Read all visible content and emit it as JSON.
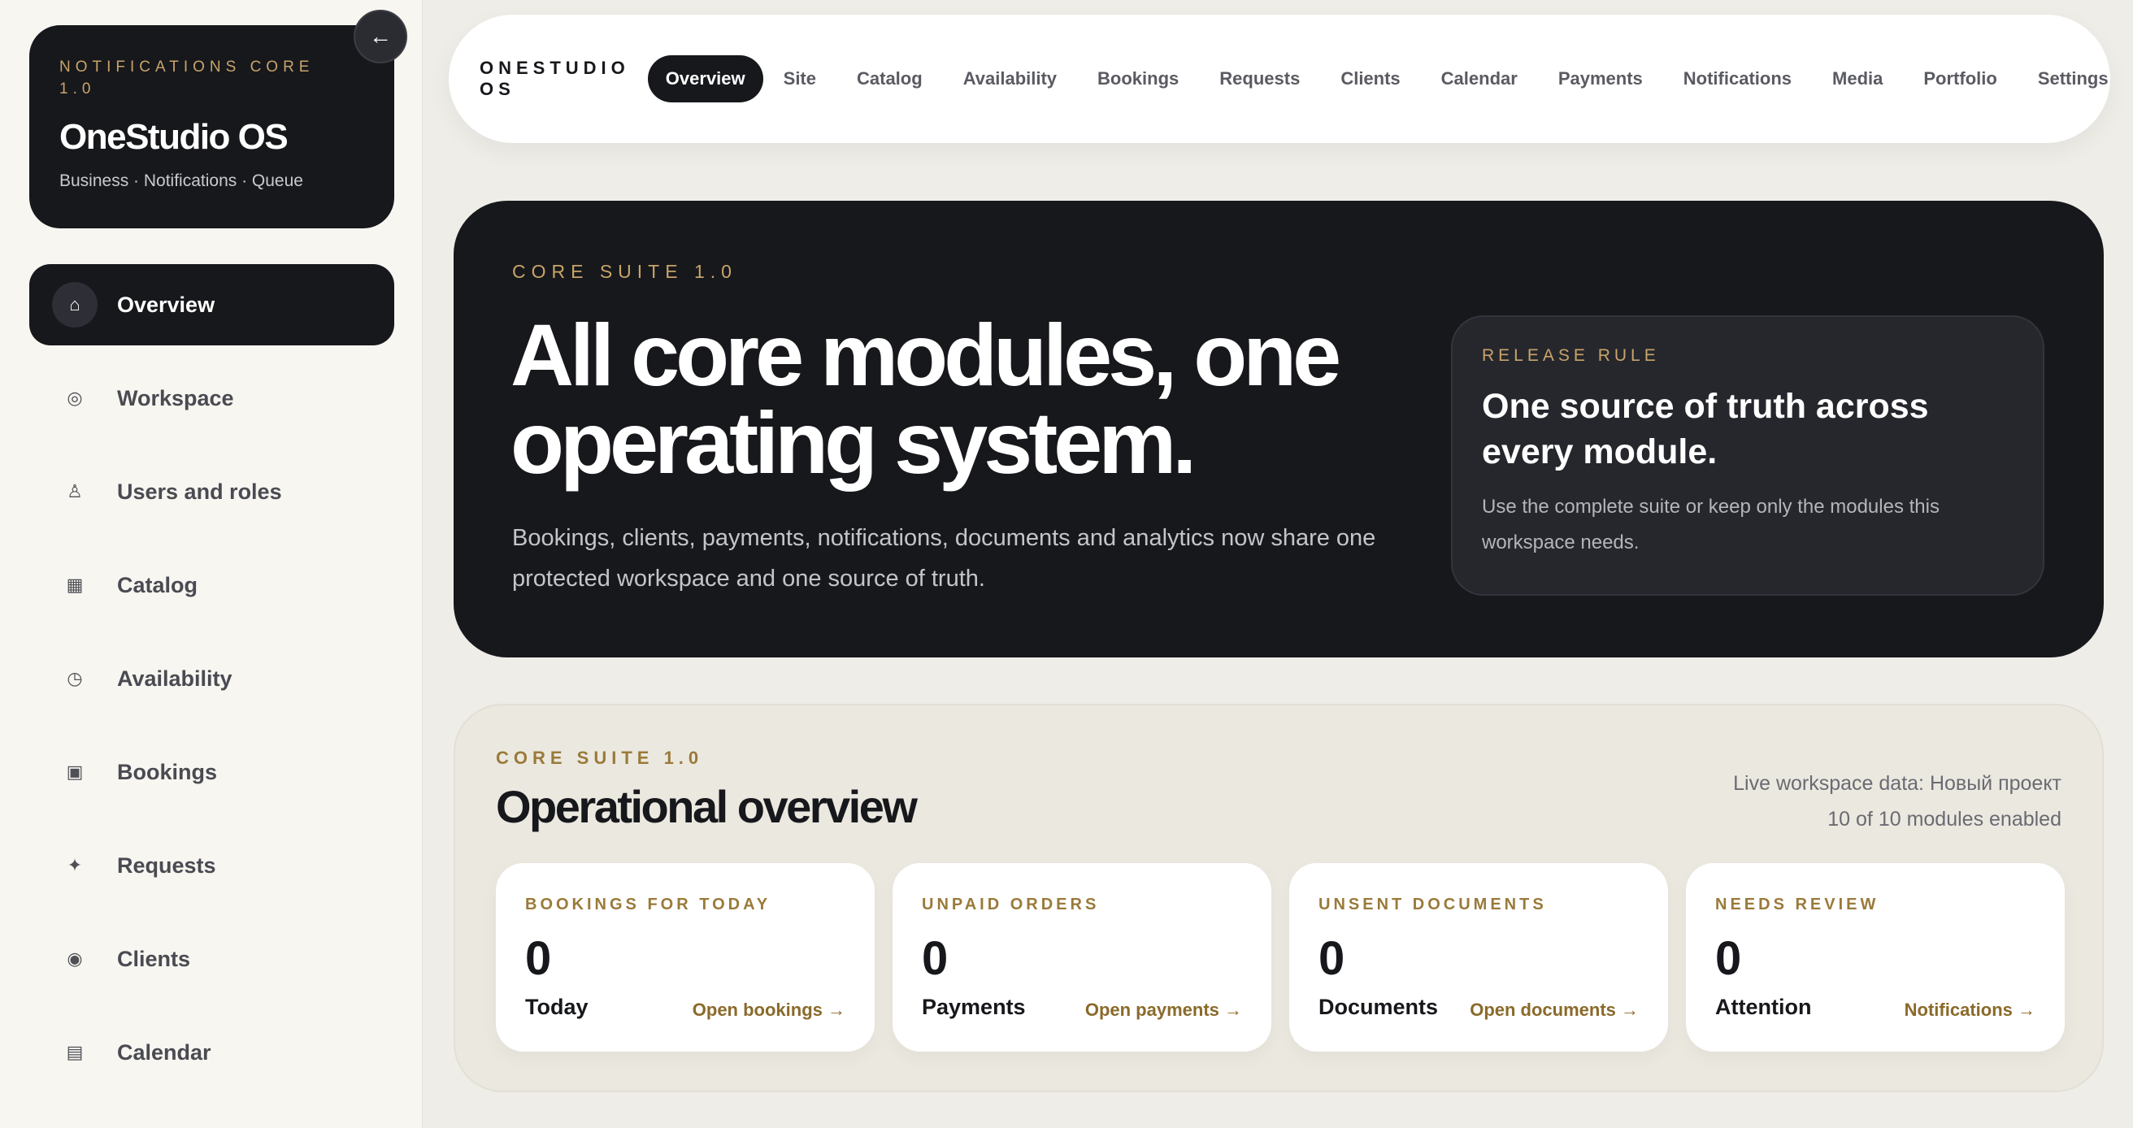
{
  "sidebar": {
    "brand": {
      "eyebrow": "NOTIFICATIONS CORE 1.0",
      "title": "OneStudio OS",
      "subtitle": "Business · Notifications · Queue",
      "collapse_glyph": "←"
    },
    "items": [
      {
        "label": "Overview",
        "icon": "home-icon",
        "glyph": "⌂",
        "active": true
      },
      {
        "label": "Workspace",
        "icon": "workspace-icon",
        "glyph": "◎"
      },
      {
        "label": "Users and roles",
        "icon": "users-icon",
        "glyph": "♙"
      },
      {
        "label": "Catalog",
        "icon": "catalog-icon",
        "glyph": "▦"
      },
      {
        "label": "Availability",
        "icon": "clock-icon",
        "glyph": "◷"
      },
      {
        "label": "Bookings",
        "icon": "bookings-icon",
        "glyph": "▣"
      },
      {
        "label": "Requests",
        "icon": "sparkle-icon",
        "glyph": "✦"
      },
      {
        "label": "Clients",
        "icon": "client-icon",
        "glyph": "◉"
      },
      {
        "label": "Calendar",
        "icon": "calendar-icon",
        "glyph": "▤"
      }
    ]
  },
  "topbar": {
    "brand": "ONESTUDIO OS",
    "tabs": [
      "Overview",
      "Site",
      "Catalog",
      "Availability",
      "Bookings",
      "Requests",
      "Clients",
      "Calendar",
      "Payments",
      "Notifications",
      "Media",
      "Portfolio",
      "Settings"
    ],
    "active_tab": "Overview"
  },
  "hero": {
    "eyebrow": "CORE SUITE 1.0",
    "title": "All core modules, one operating system.",
    "description": "Bookings, clients, payments, notifications, documents and analytics now share one protected workspace and one source of truth.",
    "rule": {
      "eyebrow": "RELEASE RULE",
      "title": "One source of truth across every module.",
      "description": "Use the complete suite or keep only the modules this workspace needs."
    }
  },
  "overview": {
    "eyebrow": "CORE SUITE 1.0",
    "title": "Operational overview",
    "meta_line1": "Live workspace data: Новый проект",
    "meta_line2": "10 of 10 modules enabled",
    "cards": [
      {
        "eyebrow": "BOOKINGS FOR TODAY",
        "value": "0",
        "label": "Today",
        "link": "Open bookings →"
      },
      {
        "eyebrow": "UNPAID ORDERS",
        "value": "0",
        "label": "Payments",
        "link": "Open payments →"
      },
      {
        "eyebrow": "UNSENT DOCUMENTS",
        "value": "0",
        "label": "Documents",
        "link": "Open documents →"
      },
      {
        "eyebrow": "NEEDS REVIEW",
        "value": "0",
        "label": "Attention",
        "link": "Notifications →"
      }
    ]
  },
  "colors": {
    "dark": "#17181c",
    "accent_gold": "#c8a46a",
    "link_gold": "#8a6a2a",
    "page_bg": "#efede7"
  }
}
